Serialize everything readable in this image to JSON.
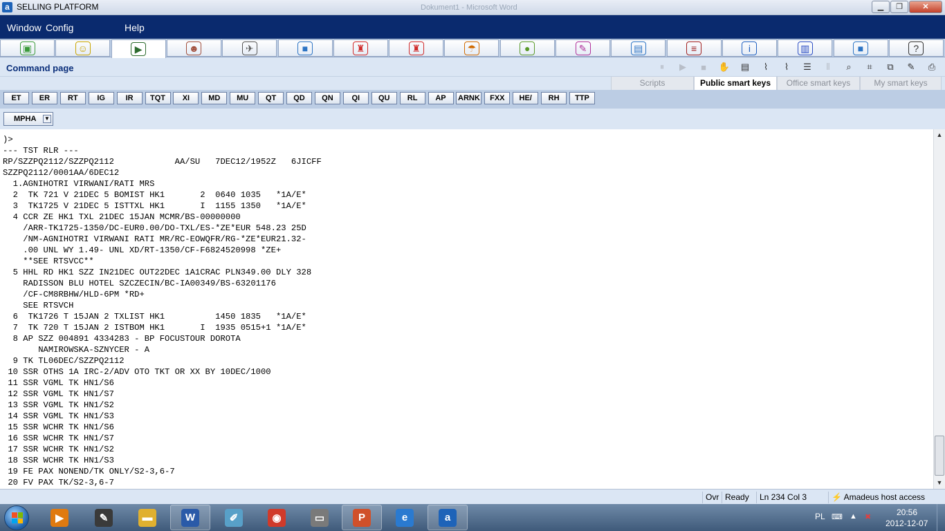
{
  "titlebar": {
    "title": "SELLING PLATFORM",
    "background_window": "Dokument1 - Microsoft Word",
    "app_icon": "a"
  },
  "menubar": {
    "items": [
      "Window",
      "Config",
      "Help"
    ]
  },
  "modules": [
    {
      "icon": "cube-icon",
      "glyph": "▣",
      "color": "#3a9a3a"
    },
    {
      "icon": "monitor-smile-icon",
      "glyph": "☺",
      "color": "#c8a400"
    },
    {
      "icon": "command-terminal-icon",
      "glyph": "▶",
      "color": "#2d6b2d"
    },
    {
      "icon": "agent-woman-icon",
      "glyph": "☻",
      "color": "#a04d3a"
    },
    {
      "icon": "pilot-icon",
      "glyph": "✈",
      "color": "#555555"
    },
    {
      "icon": "car-icon",
      "glyph": "■",
      "color": "#2c74c4"
    },
    {
      "icon": "bellboy-icon",
      "glyph": "♜",
      "color": "#d02a2a"
    },
    {
      "icon": "bellboy-add-icon",
      "glyph": "♜",
      "color": "#d02a2a"
    },
    {
      "icon": "umbrella-icon",
      "glyph": "☂",
      "color": "#d06a00"
    },
    {
      "icon": "coins-icon",
      "glyph": "●",
      "color": "#5a9a2a"
    },
    {
      "icon": "ticket-icon",
      "glyph": "✎",
      "color": "#b0309a"
    },
    {
      "icon": "documents-icon",
      "glyph": "▤",
      "color": "#2c74c4"
    },
    {
      "icon": "books-icon",
      "glyph": "≡",
      "color": "#a02020"
    },
    {
      "icon": "info-icon",
      "glyph": "i",
      "color": "#1e5fc0"
    },
    {
      "icon": "building-icon",
      "glyph": "▥",
      "color": "#2c4ec4"
    },
    {
      "icon": "car-add-icon",
      "glyph": "■",
      "color": "#2c74c4"
    },
    {
      "icon": "help-icon",
      "glyph": "?",
      "color": "#333333"
    }
  ],
  "page": {
    "title": "Command page"
  },
  "toolbar_icons": [
    {
      "name": "pause-icon",
      "glyph": "⏸",
      "dim": true
    },
    {
      "name": "play-icon",
      "glyph": "▶",
      "dim": true
    },
    {
      "name": "stop-icon",
      "glyph": "■",
      "dim": true
    },
    {
      "name": "hand-icon",
      "glyph": "✋",
      "dim": false
    },
    {
      "name": "scroll-icon",
      "glyph": "▤",
      "dim": false
    },
    {
      "name": "broom-icon",
      "glyph": "⌇",
      "dim": false
    },
    {
      "name": "broom-color-icon",
      "glyph": "⌇",
      "dim": false
    },
    {
      "name": "lines-icon",
      "glyph": "☰",
      "dim": false
    },
    {
      "name": "columns-icon",
      "glyph": "⦀",
      "dim": true
    },
    {
      "name": "magnifier-icon",
      "glyph": "⌕",
      "dim": false
    },
    {
      "name": "crop-icon",
      "glyph": "⌗",
      "dim": false
    },
    {
      "name": "copy-icon",
      "glyph": "⧉",
      "dim": false
    },
    {
      "name": "pencil-icon",
      "glyph": "✎",
      "dim": false
    },
    {
      "name": "printer-icon",
      "glyph": "⎙",
      "dim": false
    }
  ],
  "tabs": [
    "Scripts",
    "Public smart keys",
    "Office smart keys",
    "My smart keys"
  ],
  "smart_keys": [
    "ET",
    "ER",
    "RT",
    "IG",
    "IR",
    "TQT",
    "XI",
    "MD",
    "MU",
    "QT",
    "QD",
    "QN",
    "QI",
    "QU",
    "RL",
    "AP",
    "ARNK",
    "FXX",
    "HE/",
    "RH",
    "TTP"
  ],
  "mpha": {
    "label": "MPHA"
  },
  "terminal": {
    "lines": [
      ")>",
      "--- TST RLR ---",
      "RP/SZZPQ2112/SZZPQ2112            AA/SU   7DEC12/1952Z   6JICFF",
      "SZZPQ2112/0001AA/6DEC12",
      "  1.AGNIHOTRI VIRWANI/RATI MRS",
      "  2  TK 721 V 21DEC 5 BOMIST HK1       2  0640 1035   *1A/E*",
      "  3  TK1725 V 21DEC 5 ISTTXL HK1       I  1155 1350   *1A/E*",
      "  4 CCR ZE HK1 TXL 21DEC 15JAN MCMR/BS-00000000",
      "    /ARR-TK1725-1350/DC-EUR0.00/DO-TXL/ES-*ZE*EUR 548.23 25D",
      "    /NM-AGNIHOTRI VIRWANI RATI MR/RC-EOWQFR/RG-*ZE*EUR21.32-",
      "    .00 UNL WY 1.49- UNL XD/RT-1350/CF-F6824520998 *ZE+",
      "    **SEE RTSVCC**",
      "  5 HHL RD HK1 SZZ IN21DEC OUT22DEC 1A1CRAC PLN349.00 DLY 328",
      "    RADISSON BLU HOTEL SZCZECIN/BC-IA00349/BS-63201176",
      "    /CF-CM8RBHW/HLD-6PM *RD+",
      "    SEE RTSVCH",
      "  6  TK1726 T 15JAN 2 TXLIST HK1          1450 1835   *1A/E*",
      "  7  TK 720 T 15JAN 2 ISTBOM HK1       I  1935 0515+1 *1A/E*",
      "  8 AP SZZ 004891 4334283 - BP FOCUSTOUR DOROTA",
      "       NAMIROWSKA-SZNYCER - A",
      "  9 TK TL06DEC/SZZPQ2112",
      " 10 SSR OTHS 1A IRC-2/ADV OTO TKT OR XX BY 10DEC/1000",
      " 11 SSR VGML TK HN1/S6",
      " 12 SSR VGML TK HN1/S7",
      " 13 SSR VGML TK HN1/S2",
      " 14 SSR VGML TK HN1/S3",
      " 15 SSR WCHR TK HN1/S6",
      " 16 SSR WCHR TK HN1/S7",
      " 17 SSR WCHR TK HN1/S2",
      " 18 SSR WCHR TK HN1/S3",
      " 19 FE PAX NONEND/TK ONLY/S2-3,6-7",
      " 20 FV PAX TK/S2-3,6-7"
    ]
  },
  "status": {
    "mode": "Ovr",
    "state": "Ready",
    "position": "Ln 234 Col 3",
    "connection": "Amadeus host access"
  },
  "taskbar": {
    "apps": [
      {
        "icon": "media-player-icon",
        "glyph": "▶",
        "color": "#e07a10"
      },
      {
        "icon": "paint-icon",
        "glyph": "✎",
        "color": "#3a3a3a"
      },
      {
        "icon": "explorer-folder-icon",
        "glyph": "▬",
        "color": "#e0b030"
      },
      {
        "icon": "word-icon",
        "glyph": "W",
        "color": "#2a5aa8"
      },
      {
        "icon": "notes-icon",
        "glyph": "✐",
        "color": "#58a0c8"
      },
      {
        "icon": "chrome-icon",
        "glyph": "◉",
        "color": "#d03a2a"
      },
      {
        "icon": "scanner-icon",
        "glyph": "▭",
        "color": "#7a7a7a"
      },
      {
        "icon": "powerpoint-icon",
        "glyph": "P",
        "color": "#d0502a"
      },
      {
        "icon": "internet-explorer-icon",
        "glyph": "e",
        "color": "#2a7ad0"
      },
      {
        "icon": "amadeus-icon",
        "glyph": "a",
        "color": "#1e63b8"
      }
    ],
    "lang": "PL",
    "time": "20:56",
    "date": "2012-12-07"
  }
}
